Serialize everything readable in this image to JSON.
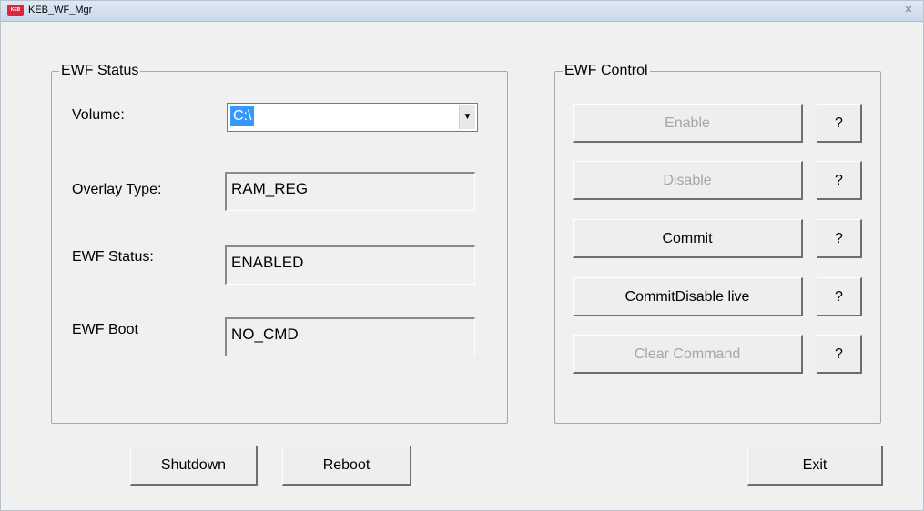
{
  "window": {
    "title": "KEB_WF_Mgr",
    "close_glyph": "✕",
    "icon_text": "KEB"
  },
  "status_group": {
    "title": "EWF Status",
    "volume_label": "Volume:",
    "volume_value": "C:\\",
    "overlay_label": "Overlay Type:",
    "overlay_value": "RAM_REG",
    "status_label": "EWF Status:",
    "status_value": "ENABLED",
    "boot_label": "EWF Boot",
    "boot_value": "NO_CMD"
  },
  "control_group": {
    "title": "EWF Control",
    "buttons": [
      {
        "label": "Enable",
        "enabled": false
      },
      {
        "label": "Disable",
        "enabled": false
      },
      {
        "label": "Commit",
        "enabled": true
      },
      {
        "label": "CommitDisable live",
        "enabled": true
      },
      {
        "label": "Clear Command",
        "enabled": false
      }
    ],
    "help_label": "?"
  },
  "footer": {
    "shutdown_label": "Shutdown",
    "reboot_label": "Reboot",
    "exit_label": "Exit"
  }
}
